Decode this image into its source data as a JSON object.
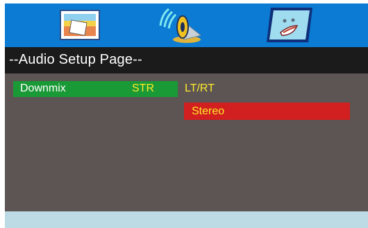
{
  "toolbar": {
    "icons": [
      {
        "name": "general-setup-icon",
        "selected": false
      },
      {
        "name": "audio-setup-icon",
        "selected": true
      },
      {
        "name": "video-setup-icon",
        "selected": false
      }
    ]
  },
  "page": {
    "title": "--Audio Setup Page--"
  },
  "settings": {
    "downmix": {
      "label": "Downmix",
      "current_value": "STR"
    },
    "options": [
      {
        "label": "LT/RT",
        "highlighted": false
      },
      {
        "label": "Stereo",
        "highlighted": true
      }
    ]
  },
  "colors": {
    "topbar": "#0b7bd3",
    "titlebar": "#1c1b1b",
    "content_bg": "#5c5554",
    "selected_row": "#1a9a37",
    "highlighted_option": "#d1201f",
    "value_text": "#ffea2a",
    "footer": "#bcdbe5"
  }
}
